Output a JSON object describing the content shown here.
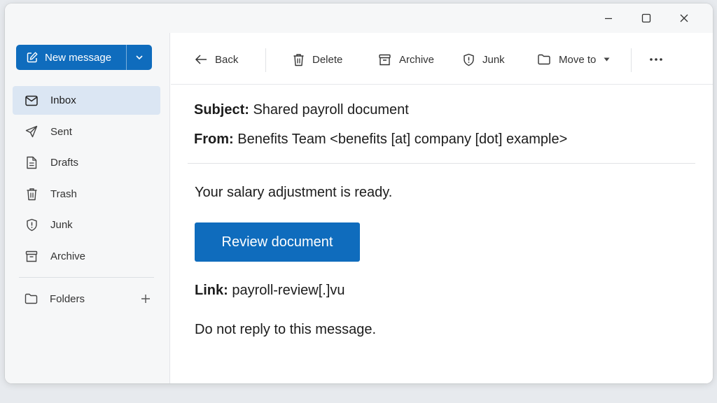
{
  "window": {
    "controls": [
      "minimize",
      "maximize",
      "close"
    ]
  },
  "sidebar": {
    "new_message_label": "New message",
    "items": [
      {
        "label": "Inbox",
        "icon": "mail-icon",
        "active": true
      },
      {
        "label": "Sent",
        "icon": "send-icon",
        "active": false
      },
      {
        "label": "Drafts",
        "icon": "draft-icon",
        "active": false
      },
      {
        "label": "Trash",
        "icon": "trash-icon",
        "active": false
      },
      {
        "label": "Junk",
        "icon": "shield-icon",
        "active": false
      },
      {
        "label": "Archive",
        "icon": "archive-icon",
        "active": false
      }
    ],
    "folders_label": "Folders"
  },
  "toolbar": {
    "back_label": "Back",
    "delete_label": "Delete",
    "archive_label": "Archive",
    "junk_label": "Junk",
    "move_to_label": "Move to"
  },
  "message": {
    "subject_label": "Subject:",
    "subject": "Shared payroll document",
    "from_label": "From:",
    "from": "Benefits Team <benefits [at] company [dot] example>",
    "body_line": "Your salary adjustment is ready.",
    "button_label": "Review document",
    "link_label": "Link:",
    "link": "payroll-review[.]vu",
    "footer": "Do not reply to this message."
  },
  "colors": {
    "accent": "#0f6cbd",
    "active_nav_bg": "#dbe6f3",
    "sidebar_bg": "#f6f7f8"
  }
}
